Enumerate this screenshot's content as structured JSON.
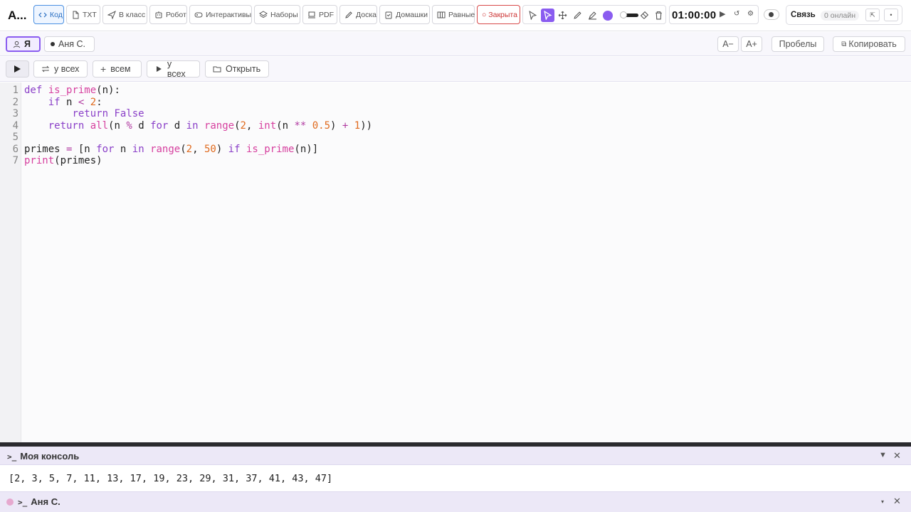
{
  "app": {
    "brand": "A..."
  },
  "toolbar": {
    "buttons": [
      {
        "label": "Код",
        "icon": "code-icon"
      },
      {
        "label": "TXT",
        "icon": "file-icon"
      },
      {
        "label": "В класс",
        "icon": "send-icon"
      },
      {
        "label": "Робот",
        "icon": "robot-icon"
      },
      {
        "label": "Интерактивы",
        "icon": "gamepad-icon"
      },
      {
        "label": "Наборы",
        "icon": "layers-icon"
      },
      {
        "label": "PDF",
        "icon": "laptop-icon"
      },
      {
        "label": "Доска",
        "icon": "pencil-icon"
      },
      {
        "label": "Домашки",
        "icon": "clipboard-icon"
      },
      {
        "label": "Равные",
        "icon": "columns-icon"
      },
      {
        "label": "○ Закрыта",
        "icon": ""
      }
    ],
    "draw_color": "#8a5cf0",
    "timer": "01:00:00",
    "comm_label": "Связь",
    "online": "0 онлайн"
  },
  "users": {
    "me": "Я",
    "other": "Аня С.",
    "font_minus": "A−",
    "font_plus": "A+",
    "spaces": "Пробелы",
    "copy": "Копировать"
  },
  "actions": {
    "swap_all": "у всех",
    "add_all": "всем",
    "run_all": "у всех",
    "open": "Открыть"
  },
  "editor": {
    "line_numbers": [
      "1",
      "2",
      "3",
      "4",
      "5",
      "6",
      "7"
    ]
  },
  "console": {
    "title": "Моя консоль",
    "output": "[2, 3, 5, 7, 11, 13, 17, 19, 23, 29, 31, 37, 41, 43, 47]",
    "peer_title": "Аня С."
  }
}
